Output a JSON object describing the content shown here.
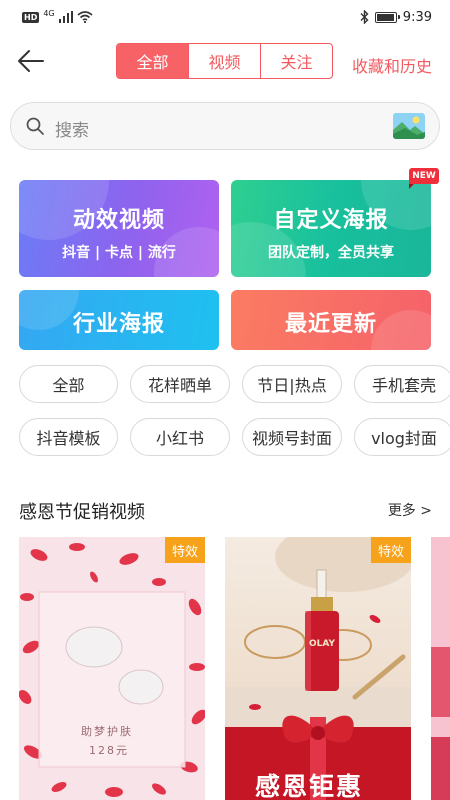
{
  "status_bar": {
    "hd": "HD",
    "network": "4G",
    "time": "9:39"
  },
  "header": {
    "tabs": [
      {
        "label": "全部",
        "active": true
      },
      {
        "label": "视频",
        "active": false
      },
      {
        "label": "关注",
        "active": false
      }
    ],
    "fav_history": "收藏和历史"
  },
  "search": {
    "placeholder": "搜索"
  },
  "feature_cards": [
    {
      "title": "动效视频",
      "subtitle": "抖音 | 卡点 | 流行"
    },
    {
      "title": "自定义海报",
      "subtitle": "团队定制，全员共享",
      "badge": "NEW"
    },
    {
      "title": "行业海报"
    },
    {
      "title": "最近更新"
    }
  ],
  "chips_row1": [
    "全部",
    "花样晒单",
    "节日|热点",
    "手机套壳"
  ],
  "chips_row2": [
    "抖音模板",
    "小红书",
    "视频号封面",
    "vlog封面"
  ],
  "section": {
    "title": "感恩节促销视频",
    "more": "更多 >"
  },
  "thumbnails": [
    {
      "badge": "特效",
      "caption": "助梦护肤",
      "price": "128元"
    },
    {
      "badge": "特效",
      "brand": "OLAY",
      "caption": "感恩钜惠"
    }
  ],
  "colors": {
    "accent": "#f25a5f",
    "badge_orange": "#f6a21b",
    "new_badge": "#ef2f3c"
  },
  "battery_level": 0.85
}
